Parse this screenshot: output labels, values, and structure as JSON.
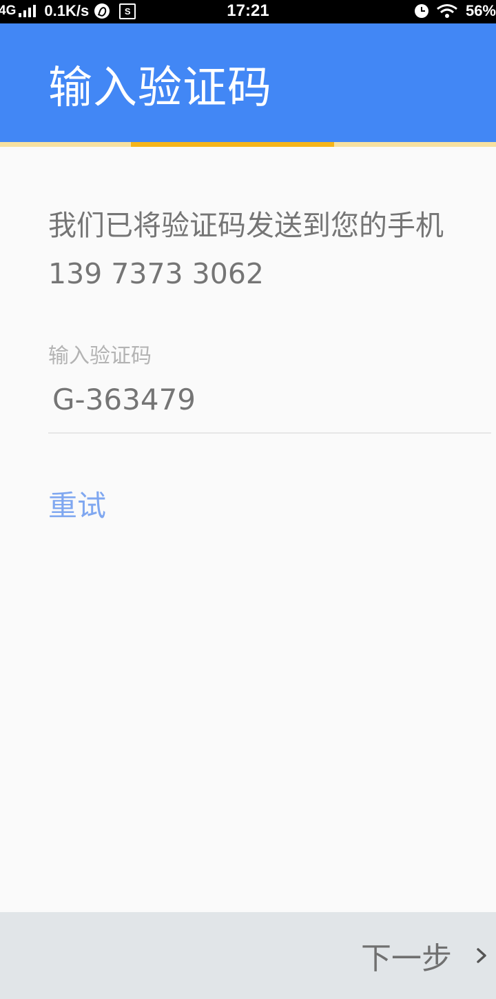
{
  "status_bar": {
    "network": "4G",
    "speed": "0.1K/s",
    "time": "17:21",
    "battery": "56%",
    "s_badge": "S"
  },
  "header": {
    "title": "输入验证码",
    "bar_color": "#4287f5",
    "progress_color": "#f5b51a"
  },
  "main": {
    "message": "我们已将验证码发送到您的手机 139 7373 3062",
    "code_label": "输入验证码",
    "code_value": "G-363479",
    "retry_label": "重试"
  },
  "footer": {
    "next_label": "下一步"
  }
}
